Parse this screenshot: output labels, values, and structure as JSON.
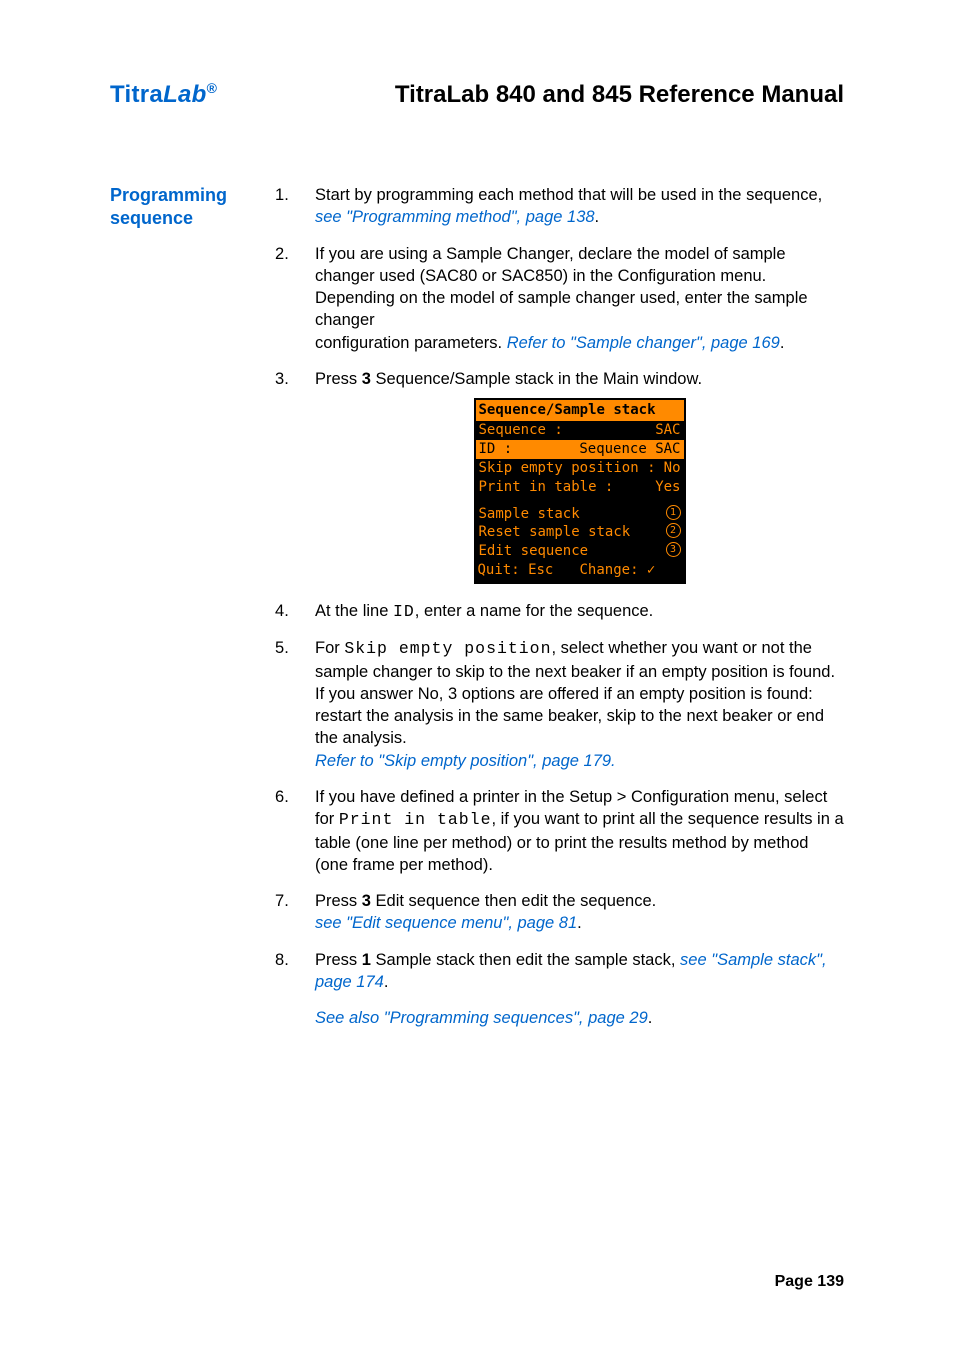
{
  "header": {
    "brand_pre": "Titra",
    "brand_ital": "Lab",
    "brand_reg": "®",
    "title": "TitraLab 840 and 845 Reference Manual"
  },
  "sidebar": {
    "heading_l1": "Programming",
    "heading_l2": "sequence"
  },
  "steps": {
    "s1_a": "Start by programming each method that will be used in the sequence, ",
    "s1_link": " see \"Programming method\", page 138",
    "s1_dot": ".",
    "s2_a": "If you are using a Sample Changer, declare the model of sample changer used (SAC80 or SAC850) in the Configuration menu. Depending on the model of sample changer used, enter the sample changer",
    "s2_b": "configuration parameters. ",
    "s2_link": "Refer to \"Sample changer\", page 169",
    "s2_dot": ".",
    "s3_a": "Press ",
    "s3_key": "3",
    "s3_b": " Sequence/Sample stack in the Main window.",
    "s4_a": "At the line ",
    "s4_kw": "ID",
    "s4_b": ", enter a name for the sequence.",
    "s5_a": "For ",
    "s5_kw": "Skip empty position",
    "s5_b": ", select whether you want or not the sample changer to skip to the next beaker if an empty position is found. If you answer No, 3 options are offered if an empty position is found: restart the analysis in the same beaker, skip to the next beaker or end the analysis.",
    "s5_link": "Refer to \"Skip empty position\", page 179.",
    "s6_a": "If you have defined a printer in the Setup > Configuration menu, select for ",
    "s6_kw": "Print in table",
    "s6_b": ", if you want to print all the sequence results in a table (one line per method) or to print the results method by method (one frame per method).",
    "s7_a": "Press ",
    "s7_key": "3",
    "s7_b": " Edit sequence then edit the sequence.",
    "s7_link": " see \"Edit sequence menu\", page 81",
    "s7_dot": ".",
    "s8_a": "Press ",
    "s8_key": "1",
    "s8_b": " Sample stack then edit the sample stack, ",
    "s8_link": " see \"Sample stack\", page 174",
    "s8_dot": "."
  },
  "see_also": {
    "link": " See also \"Programming sequences\", page 29",
    "dot": "."
  },
  "lcd": {
    "title": "Sequence/Sample stack",
    "r1l": "Sequence :",
    "r1r": "SAC",
    "r2l": "ID :",
    "r2r": "Sequence SAC",
    "r3l": "Skip empty position :",
    "r3r": "No",
    "r4l": "Print in table :",
    "r4r": "Yes",
    "r5": "Sample stack",
    "r5n": "1",
    "r6": "Reset sample stack",
    "r6n": "2",
    "r7": "Edit sequence",
    "r7n": "3",
    "f1": "Quit: Esc",
    "f2": "Change: ✓"
  },
  "footer": {
    "page": "Page 139"
  }
}
